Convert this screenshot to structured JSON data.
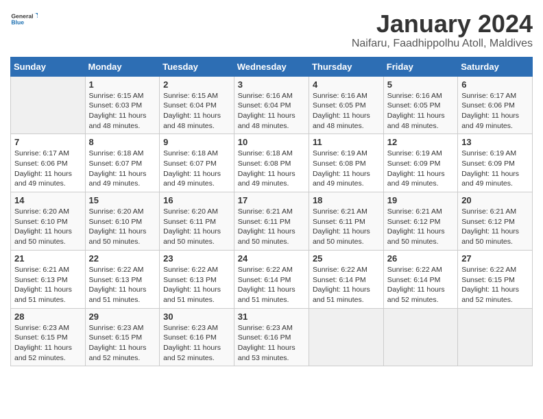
{
  "header": {
    "logo_general": "General",
    "logo_blue": "Blue",
    "title": "January 2024",
    "subtitle": "Naifaru, Faadhippolhu Atoll, Maldives"
  },
  "days_of_week": [
    "Sunday",
    "Monday",
    "Tuesday",
    "Wednesday",
    "Thursday",
    "Friday",
    "Saturday"
  ],
  "weeks": [
    [
      {
        "day": "",
        "sunrise": "",
        "sunset": "",
        "daylight": ""
      },
      {
        "day": "1",
        "sunrise": "Sunrise: 6:15 AM",
        "sunset": "Sunset: 6:03 PM",
        "daylight": "Daylight: 11 hours and 48 minutes."
      },
      {
        "day": "2",
        "sunrise": "Sunrise: 6:15 AM",
        "sunset": "Sunset: 6:04 PM",
        "daylight": "Daylight: 11 hours and 48 minutes."
      },
      {
        "day": "3",
        "sunrise": "Sunrise: 6:16 AM",
        "sunset": "Sunset: 6:04 PM",
        "daylight": "Daylight: 11 hours and 48 minutes."
      },
      {
        "day": "4",
        "sunrise": "Sunrise: 6:16 AM",
        "sunset": "Sunset: 6:05 PM",
        "daylight": "Daylight: 11 hours and 48 minutes."
      },
      {
        "day": "5",
        "sunrise": "Sunrise: 6:16 AM",
        "sunset": "Sunset: 6:05 PM",
        "daylight": "Daylight: 11 hours and 48 minutes."
      },
      {
        "day": "6",
        "sunrise": "Sunrise: 6:17 AM",
        "sunset": "Sunset: 6:06 PM",
        "daylight": "Daylight: 11 hours and 49 minutes."
      }
    ],
    [
      {
        "day": "7",
        "sunrise": "Sunrise: 6:17 AM",
        "sunset": "Sunset: 6:06 PM",
        "daylight": "Daylight: 11 hours and 49 minutes."
      },
      {
        "day": "8",
        "sunrise": "Sunrise: 6:18 AM",
        "sunset": "Sunset: 6:07 PM",
        "daylight": "Daylight: 11 hours and 49 minutes."
      },
      {
        "day": "9",
        "sunrise": "Sunrise: 6:18 AM",
        "sunset": "Sunset: 6:07 PM",
        "daylight": "Daylight: 11 hours and 49 minutes."
      },
      {
        "day": "10",
        "sunrise": "Sunrise: 6:18 AM",
        "sunset": "Sunset: 6:08 PM",
        "daylight": "Daylight: 11 hours and 49 minutes."
      },
      {
        "day": "11",
        "sunrise": "Sunrise: 6:19 AM",
        "sunset": "Sunset: 6:08 PM",
        "daylight": "Daylight: 11 hours and 49 minutes."
      },
      {
        "day": "12",
        "sunrise": "Sunrise: 6:19 AM",
        "sunset": "Sunset: 6:09 PM",
        "daylight": "Daylight: 11 hours and 49 minutes."
      },
      {
        "day": "13",
        "sunrise": "Sunrise: 6:19 AM",
        "sunset": "Sunset: 6:09 PM",
        "daylight": "Daylight: 11 hours and 49 minutes."
      }
    ],
    [
      {
        "day": "14",
        "sunrise": "Sunrise: 6:20 AM",
        "sunset": "Sunset: 6:10 PM",
        "daylight": "Daylight: 11 hours and 50 minutes."
      },
      {
        "day": "15",
        "sunrise": "Sunrise: 6:20 AM",
        "sunset": "Sunset: 6:10 PM",
        "daylight": "Daylight: 11 hours and 50 minutes."
      },
      {
        "day": "16",
        "sunrise": "Sunrise: 6:20 AM",
        "sunset": "Sunset: 6:11 PM",
        "daylight": "Daylight: 11 hours and 50 minutes."
      },
      {
        "day": "17",
        "sunrise": "Sunrise: 6:21 AM",
        "sunset": "Sunset: 6:11 PM",
        "daylight": "Daylight: 11 hours and 50 minutes."
      },
      {
        "day": "18",
        "sunrise": "Sunrise: 6:21 AM",
        "sunset": "Sunset: 6:11 PM",
        "daylight": "Daylight: 11 hours and 50 minutes."
      },
      {
        "day": "19",
        "sunrise": "Sunrise: 6:21 AM",
        "sunset": "Sunset: 6:12 PM",
        "daylight": "Daylight: 11 hours and 50 minutes."
      },
      {
        "day": "20",
        "sunrise": "Sunrise: 6:21 AM",
        "sunset": "Sunset: 6:12 PM",
        "daylight": "Daylight: 11 hours and 50 minutes."
      }
    ],
    [
      {
        "day": "21",
        "sunrise": "Sunrise: 6:21 AM",
        "sunset": "Sunset: 6:13 PM",
        "daylight": "Daylight: 11 hours and 51 minutes."
      },
      {
        "day": "22",
        "sunrise": "Sunrise: 6:22 AM",
        "sunset": "Sunset: 6:13 PM",
        "daylight": "Daylight: 11 hours and 51 minutes."
      },
      {
        "day": "23",
        "sunrise": "Sunrise: 6:22 AM",
        "sunset": "Sunset: 6:13 PM",
        "daylight": "Daylight: 11 hours and 51 minutes."
      },
      {
        "day": "24",
        "sunrise": "Sunrise: 6:22 AM",
        "sunset": "Sunset: 6:14 PM",
        "daylight": "Daylight: 11 hours and 51 minutes."
      },
      {
        "day": "25",
        "sunrise": "Sunrise: 6:22 AM",
        "sunset": "Sunset: 6:14 PM",
        "daylight": "Daylight: 11 hours and 51 minutes."
      },
      {
        "day": "26",
        "sunrise": "Sunrise: 6:22 AM",
        "sunset": "Sunset: 6:14 PM",
        "daylight": "Daylight: 11 hours and 52 minutes."
      },
      {
        "day": "27",
        "sunrise": "Sunrise: 6:22 AM",
        "sunset": "Sunset: 6:15 PM",
        "daylight": "Daylight: 11 hours and 52 minutes."
      }
    ],
    [
      {
        "day": "28",
        "sunrise": "Sunrise: 6:23 AM",
        "sunset": "Sunset: 6:15 PM",
        "daylight": "Daylight: 11 hours and 52 minutes."
      },
      {
        "day": "29",
        "sunrise": "Sunrise: 6:23 AM",
        "sunset": "Sunset: 6:15 PM",
        "daylight": "Daylight: 11 hours and 52 minutes."
      },
      {
        "day": "30",
        "sunrise": "Sunrise: 6:23 AM",
        "sunset": "Sunset: 6:16 PM",
        "daylight": "Daylight: 11 hours and 52 minutes."
      },
      {
        "day": "31",
        "sunrise": "Sunrise: 6:23 AM",
        "sunset": "Sunset: 6:16 PM",
        "daylight": "Daylight: 11 hours and 53 minutes."
      },
      {
        "day": "",
        "sunrise": "",
        "sunset": "",
        "daylight": ""
      },
      {
        "day": "",
        "sunrise": "",
        "sunset": "",
        "daylight": ""
      },
      {
        "day": "",
        "sunrise": "",
        "sunset": "",
        "daylight": ""
      }
    ]
  ]
}
